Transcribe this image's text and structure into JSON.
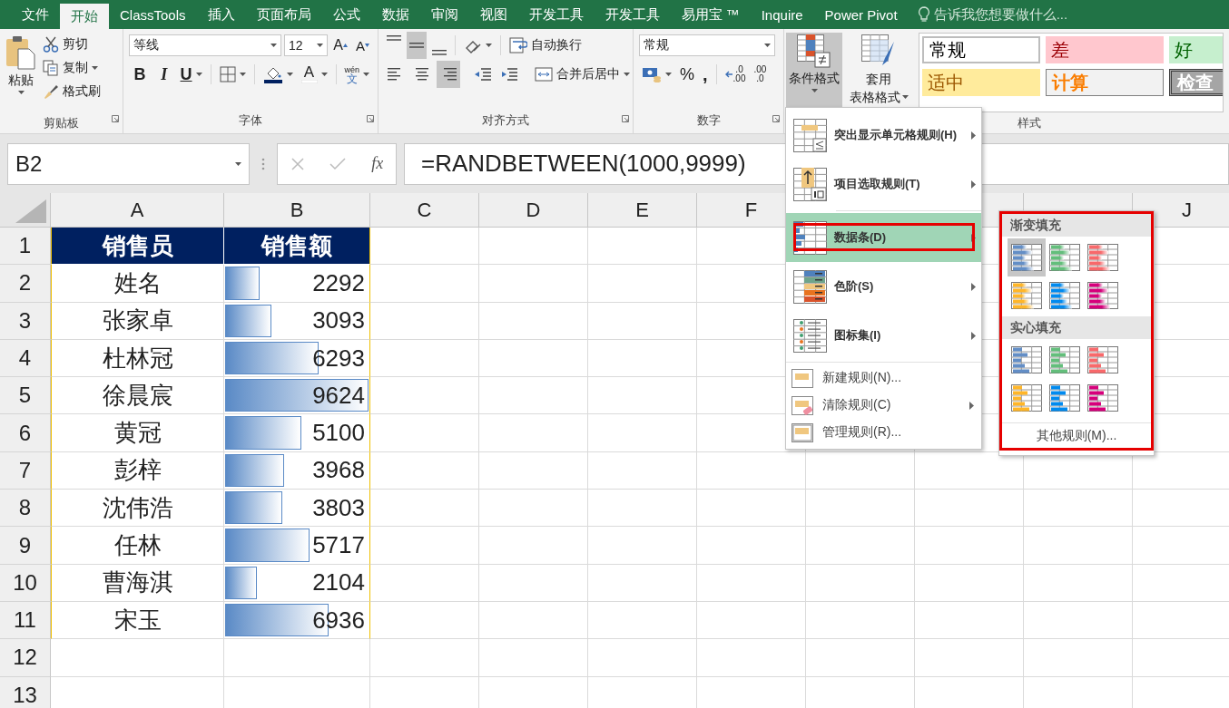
{
  "tabs": [
    {
      "label": "文件",
      "selected": false
    },
    {
      "label": "开始",
      "selected": true
    },
    {
      "label": "ClassTools",
      "selected": false
    },
    {
      "label": "插入",
      "selected": false
    },
    {
      "label": "页面布局",
      "selected": false
    },
    {
      "label": "公式",
      "selected": false
    },
    {
      "label": "数据",
      "selected": false
    },
    {
      "label": "审阅",
      "selected": false
    },
    {
      "label": "视图",
      "selected": false
    },
    {
      "label": "开发工具",
      "selected": false
    },
    {
      "label": "开发工具",
      "selected": false
    },
    {
      "label": "易用宝 ™",
      "selected": false
    },
    {
      "label": "Inquire",
      "selected": false
    },
    {
      "label": "Power Pivot",
      "selected": false
    }
  ],
  "tell_me": {
    "placeholder": "告诉我您想要做什么..."
  },
  "clipboard": {
    "label": "剪贴板",
    "paste": "粘贴",
    "cut": "剪切",
    "copy": "复制",
    "format_painter": "格式刷"
  },
  "font": {
    "label": "字体",
    "font_name": "等线",
    "font_size": "12",
    "grow": "A",
    "shrink": "A",
    "bold": "B",
    "italic": "I",
    "underline": "U",
    "font_color": "A",
    "phonetic_top": "wén",
    "phonetic_bottom": "文"
  },
  "alignment": {
    "label": "对齐方式",
    "wrap_text": "自动换行",
    "merge_center": "合并后居中",
    "vertical": [
      {
        "kind": "top",
        "selected": false
      },
      {
        "kind": "middle",
        "selected": true
      },
      {
        "kind": "bottom",
        "selected": false
      }
    ],
    "horizontal": [
      {
        "kind": "left",
        "selected": false
      },
      {
        "kind": "center",
        "selected": false
      },
      {
        "kind": "right",
        "selected": true
      }
    ]
  },
  "number": {
    "label": "数字",
    "format": "常规",
    "percent": "%",
    "comma": ",",
    "increase_decimal": [
      ".0",
      ".00"
    ],
    "decrease_decimal": [
      ".00",
      ".0"
    ]
  },
  "styles": {
    "label": "样式",
    "conditional_formatting": "条件格式",
    "conditional_open": true,
    "format_as_table_top": "套用",
    "format_as_table_bottom": "表格格式",
    "gallery": [
      {
        "label": "常规",
        "kind": "normal"
      },
      {
        "label": "差",
        "kind": "bad"
      },
      {
        "label": "好",
        "kind": "good"
      },
      {
        "label": "适中",
        "kind": "neutral"
      },
      {
        "label": "计算",
        "kind": "calculation"
      },
      {
        "label": "检查",
        "kind": "check"
      }
    ]
  },
  "formula_bar": {
    "name_box": "B2",
    "fx": "fx",
    "formula": "=RANDBETWEEN(1000,9999)"
  },
  "columns": [
    "A",
    "B",
    "C",
    "D",
    "E",
    "F",
    "J"
  ],
  "header_row": {
    "number": "1",
    "name": "销售员",
    "value": "销售额"
  },
  "rows": [
    {
      "number": "2",
      "name": "姓名",
      "value": "2292",
      "level": 0.24
    },
    {
      "number": "3",
      "name": "张家卓",
      "value": "3093",
      "level": 0.32
    },
    {
      "number": "4",
      "name": "杜林冠",
      "value": "6293",
      "level": 0.65
    },
    {
      "number": "5",
      "name": "徐晨宸",
      "value": "9624",
      "level": 1
    },
    {
      "number": "6",
      "name": "黄冠",
      "value": "5100",
      "level": 0.53
    },
    {
      "number": "7",
      "name": "彭梓",
      "value": "3968",
      "level": 0.41
    },
    {
      "number": "8",
      "name": "沈伟浩",
      "value": "3803",
      "level": 0.4
    },
    {
      "number": "9",
      "name": "任林",
      "value": "5717",
      "level": 0.59
    },
    {
      "number": "10",
      "name": "曹海淇",
      "value": "2104",
      "level": 0.22
    },
    {
      "number": "11",
      "name": "宋玉",
      "value": "6936",
      "level": 0.72
    }
  ],
  "empty_rows": [
    "12",
    "13"
  ],
  "menu": {
    "items": [
      {
        "label": "突出显示单元格规则(H)",
        "kind": "highlight",
        "submenu": true,
        "selected": false,
        "outlined": false
      },
      {
        "label": "项目选取规则(T)",
        "kind": "top10",
        "submenu": true,
        "selected": false,
        "outlined": false
      },
      {
        "label": "数据条(D)",
        "kind": "databar",
        "submenu": true,
        "selected": true,
        "outlined": true
      },
      {
        "label": "色阶(S)",
        "kind": "colorscale",
        "submenu": true,
        "selected": false,
        "outlined": false
      },
      {
        "label": "图标集(I)",
        "kind": "iconset",
        "submenu": true,
        "selected": false,
        "outlined": false
      },
      {
        "label": "新建规则(N)...",
        "kind": "new",
        "submenu": false,
        "selected": false,
        "outlined": false
      },
      {
        "label": "清除规则(C)",
        "kind": "clear",
        "submenu": true,
        "selected": false,
        "outlined": false
      },
      {
        "label": "管理规则(R)...",
        "kind": "manage",
        "submenu": false,
        "selected": false,
        "outlined": false
      }
    ]
  },
  "submenu": {
    "outlined": true,
    "sections": [
      {
        "title": "渐变填充",
        "kind": "gradient",
        "swatches": [
          {
            "color": "#638ec6",
            "selected": true
          },
          {
            "color": "#63be7b",
            "selected": false
          },
          {
            "color": "#f8696b",
            "selected": false
          },
          {
            "color": "#ffb628",
            "selected": false
          },
          {
            "color": "#008aef",
            "selected": false
          },
          {
            "color": "#d6007b",
            "selected": false
          }
        ]
      },
      {
        "title": "实心填充",
        "kind": "solid",
        "swatches": [
          {
            "color": "#638ec6",
            "selected": false
          },
          {
            "color": "#63be7b",
            "selected": false
          },
          {
            "color": "#f8696b",
            "selected": false
          },
          {
            "color": "#ffb628",
            "selected": false
          },
          {
            "color": "#008aef",
            "selected": false
          },
          {
            "color": "#d6007b",
            "selected": false
          }
        ]
      }
    ],
    "more": "其他规则(M)..."
  }
}
